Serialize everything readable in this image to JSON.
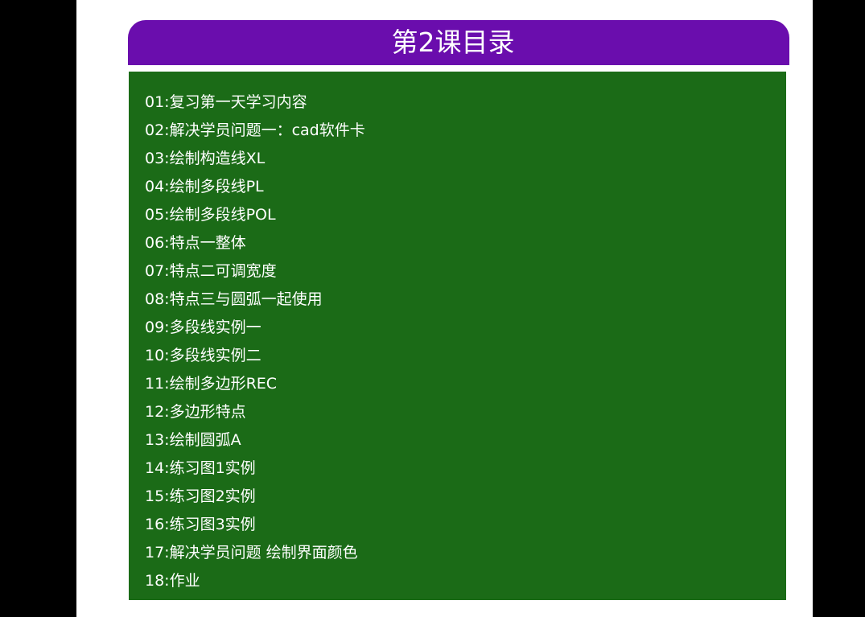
{
  "colors": {
    "outer_background": "#000000",
    "page_background": "#ffffff",
    "header_background": "#6a0dad",
    "panel_background": "#1b6b17",
    "text": "#ffffff"
  },
  "header": {
    "title": "第2课目录"
  },
  "lessons": [
    "01:复习第一天学习内容",
    "02:解决学员问题一：cad软件卡",
    "03:绘制构造线XL",
    "04:绘制多段线PL",
    "05:绘制多段线POL",
    "06:特点一整体",
    "07:特点二可调宽度",
    "08:特点三与圆弧一起使用",
    "09:多段线实例一",
    "10:多段线实例二",
    "11:绘制多边形REC",
    "12:多边形特点",
    "13:绘制圆弧A",
    "14:练习图1实例",
    "15:练习图2实例",
    "16:练习图3实例",
    "17:解决学员问题 绘制界面颜色",
    "18:作业"
  ]
}
